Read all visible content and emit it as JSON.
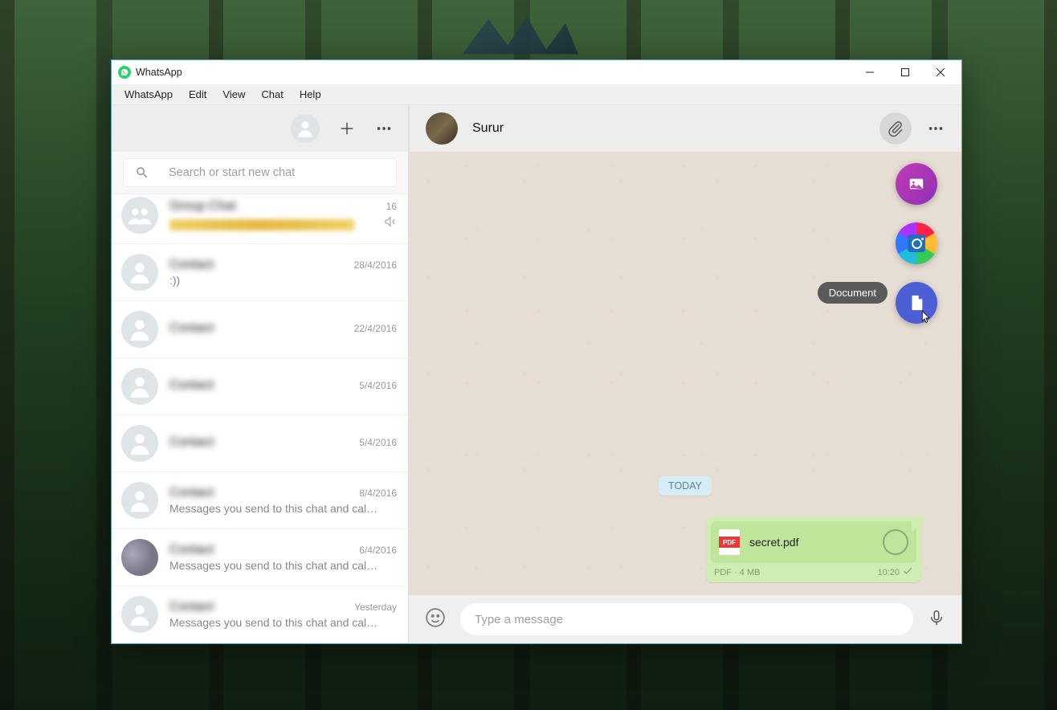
{
  "window": {
    "title": "WhatsApp"
  },
  "menu": {
    "items": [
      "WhatsApp",
      "Edit",
      "View",
      "Chat",
      "Help"
    ]
  },
  "search": {
    "placeholder": "Search or start new chat"
  },
  "chat_header": {
    "name": "Surur"
  },
  "chats": [
    {
      "name": "Group Chat",
      "time": "16",
      "preview": "",
      "muted": true,
      "blurbar": true,
      "avatar": "group"
    },
    {
      "name": "Contact",
      "time": "28/4/2016",
      "preview": ":))",
      "avatar": "person"
    },
    {
      "name": "Contact",
      "time": "22/4/2016",
      "preview": " ",
      "avatar": "person",
      "preview_blur": true
    },
    {
      "name": "Contact",
      "time": "5/4/2016",
      "preview": " ",
      "avatar": "person",
      "preview_blur": true
    },
    {
      "name": "Contact",
      "time": "5/4/2016",
      "preview": " ",
      "avatar": "person",
      "preview_blur": true
    },
    {
      "name": "Contact",
      "time": "8/4/2016",
      "preview": "Messages you send to this chat and calls ...",
      "avatar": "person"
    },
    {
      "name": "Contact",
      "time": "6/4/2016",
      "preview": "Messages you send to this chat and calls ...",
      "avatar": "photo"
    },
    {
      "name": "Contact",
      "time": "Yesterday",
      "preview": "Messages you send to this chat and calls ...",
      "avatar": "person"
    }
  ],
  "conversation": {
    "date_label": "TODAY",
    "message": {
      "filename": "secret.pdf",
      "pdf_badge": "PDF",
      "meta_left": "PDF · 4 MB",
      "time": "10:20"
    }
  },
  "attach_menu": {
    "tooltip": "Document"
  },
  "composer": {
    "placeholder": "Type a message"
  }
}
